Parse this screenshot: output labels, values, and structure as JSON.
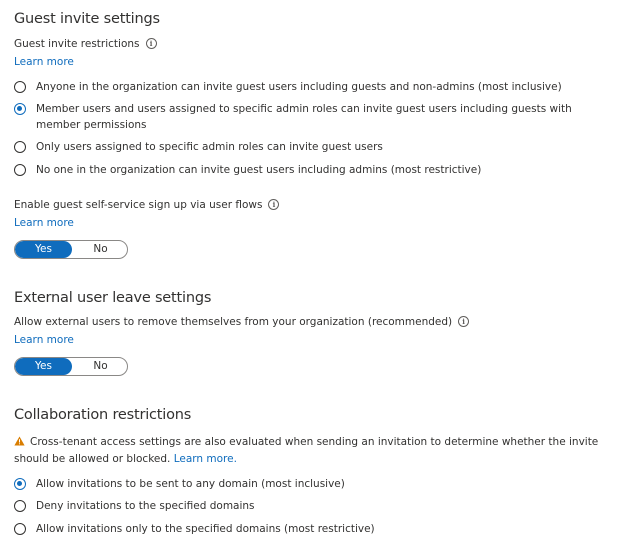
{
  "guest_invite": {
    "title": "Guest invite settings",
    "restrictions_label": "Guest invite restrictions",
    "learn_more": "Learn more",
    "options": [
      {
        "label": "Anyone in the organization can invite guest users including guests and non-admins (most inclusive)",
        "selected": false
      },
      {
        "label_line1": "Member users and users assigned to specific admin roles can invite guest users including guests with",
        "label_line2": "member permissions",
        "selected": true
      },
      {
        "label": "Only users assigned to specific admin roles can invite guest users",
        "selected": false
      },
      {
        "label": "No one in the organization can invite guest users including admins (most restrictive)",
        "selected": false
      }
    ],
    "self_service_label": "Enable guest self-service sign up via user flows",
    "self_service_learn_more": "Learn more",
    "self_service_toggle": {
      "yes": "Yes",
      "no": "No",
      "value": "Yes"
    }
  },
  "external_leave": {
    "title": "External user leave settings",
    "allow_label": "Allow external users to remove themselves from your organization (recommended)",
    "learn_more": "Learn more",
    "toggle": {
      "yes": "Yes",
      "no": "No",
      "value": "Yes"
    }
  },
  "collaboration": {
    "title": "Collaboration restrictions",
    "warning_line1": "Cross-tenant access settings are also evaluated when sending an invitation to determine whether the invite",
    "warning_line2": "should be allowed or blocked.",
    "warning_link": "Learn more.",
    "options": [
      {
        "label": "Allow invitations to be sent to any domain (most inclusive)",
        "selected": true
      },
      {
        "label": "Deny invitations to the specified domains",
        "selected": false
      },
      {
        "label": "Allow invitations only to the specified domains (most restrictive)",
        "selected": false
      }
    ]
  },
  "icons": {
    "info": "info-icon",
    "warning": "warning-icon"
  },
  "colors": {
    "accent": "#0f6cbd",
    "warning": "#d97d00",
    "text": "#323130"
  }
}
